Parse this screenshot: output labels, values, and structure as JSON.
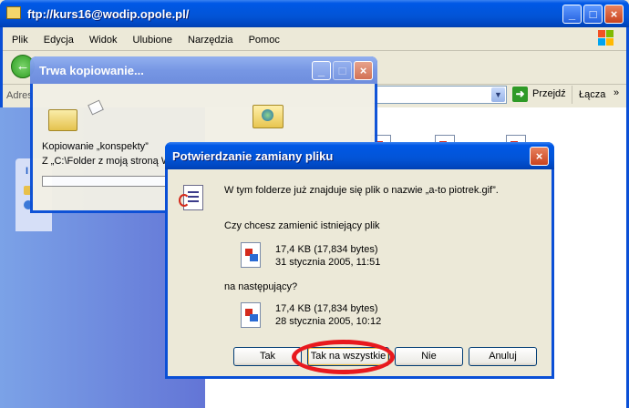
{
  "explorer": {
    "title": "ftp://kurs16@wodip.opole.pl/",
    "menu": [
      "Plik",
      "Edycja",
      "Widok",
      "Ulubione",
      "Narzędzia",
      "Pomoc"
    ],
    "address_label": "Adres",
    "go_label": "Przejdź",
    "links_label": "Łącza",
    "side_panel_letter": "I"
  },
  "copy_dialog": {
    "title": "Trwa kopiowanie...",
    "line1": "Kopiowanie „konspekty”",
    "line2": "Z „C:\\Folder z moją stroną W"
  },
  "confirm_dialog": {
    "title": "Potwierdzanie zamiany pliku",
    "message": "W tym folderze już znajduje się plik o nazwie „a-to piotrek.gif”.",
    "question": "Czy chcesz zamienić istniejący plik",
    "existing": {
      "size": "17,4 KB (17,834 bytes)",
      "date": "31 stycznia 2005, 11:51"
    },
    "with_label": "na następujący?",
    "new_file": {
      "size": "17,4 KB (17,834 bytes)",
      "date": "28 stycznia 2005, 10:12"
    },
    "buttons": {
      "yes": "Tak",
      "yes_all": "Tak na wszystkie",
      "no": "Nie",
      "cancel": "Anuluj"
    }
  },
  "colors": {
    "highlight_ring": "#E8191E",
    "titlebar": "#0054E3"
  }
}
